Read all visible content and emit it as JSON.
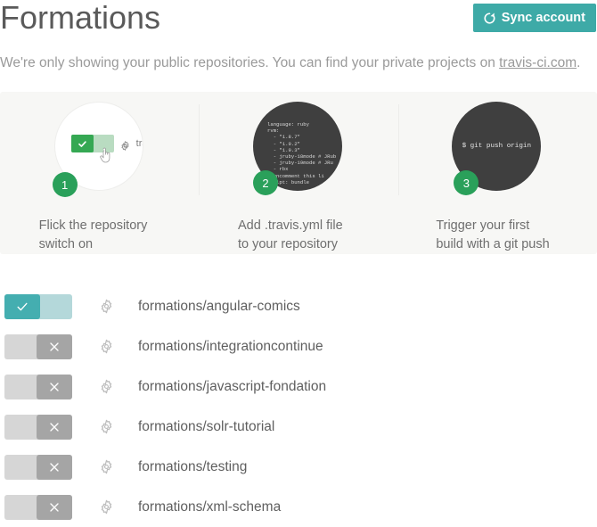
{
  "header": {
    "title": "Formations",
    "sync_button_label": "Sync account",
    "sync_icon": "refresh-icon",
    "accent_color": "#3eaaa7"
  },
  "subtitle": {
    "text_before": "We're only showing your public repositories. You can find your private projects on ",
    "link_text": "travis-ci.com",
    "text_after": "."
  },
  "onboarding": {
    "steps": [
      {
        "number": "1",
        "caption": "Flick the repository\nswitch on",
        "illustration": {
          "type": "toggle-mock",
          "gear_icon": "gear-icon",
          "repo_text": "tra",
          "cursor_icon": "pointing-hand-cursor",
          "toggle_state": "on"
        }
      },
      {
        "number": "2",
        "caption": "Add .travis.yml file\nto your repository",
        "illustration": {
          "type": "code-block",
          "code": "language: ruby\nrvm:\n  - \"1.8.7\"\n  - \"1.9.2\"\n  - \"1.9.3\"\n  - jruby-18mode # JRub\n  - jruby-19mode # JRu\n  - rbx\n# uncomment this li\nscript: bundle"
        }
      },
      {
        "number": "3",
        "caption": "Trigger your first\nbuild with a git push",
        "illustration": {
          "type": "terminal",
          "command": "$ git push origin"
        }
      }
    ],
    "badge_color": "#2aa05a",
    "panel_bg": "#f7f7f5"
  },
  "repositories": [
    {
      "name": "formations/angular-comics",
      "enabled": true,
      "settings_icon": "gear-icon"
    },
    {
      "name": "formations/integrationcontinue",
      "enabled": false,
      "settings_icon": "gear-icon"
    },
    {
      "name": "formations/javascript-fondation",
      "enabled": false,
      "settings_icon": "gear-icon"
    },
    {
      "name": "formations/solr-tutorial",
      "enabled": false,
      "settings_icon": "gear-icon"
    },
    {
      "name": "formations/testing",
      "enabled": false,
      "settings_icon": "gear-icon"
    },
    {
      "name": "formations/xml-schema",
      "enabled": false,
      "settings_icon": "gear-icon"
    }
  ],
  "colors": {
    "toggle_on_track": "#b4d8da",
    "toggle_on_knob": "#44aeb0",
    "toggle_off_track": "#d6d6d6",
    "toggle_off_knob": "#a5a5a5"
  }
}
